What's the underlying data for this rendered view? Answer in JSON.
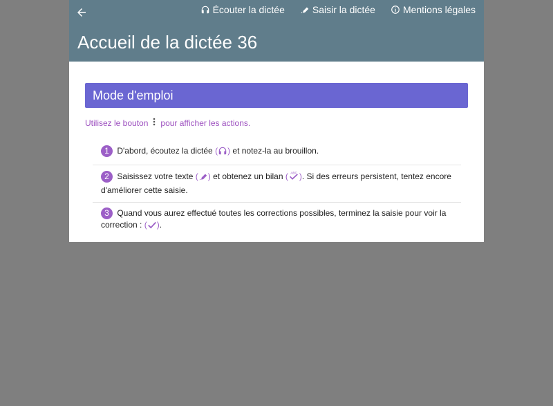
{
  "header": {
    "title": "Accueil de la dictée 36",
    "background": "#607d8b",
    "nav": [
      {
        "icon": "headphones-icon",
        "label": "Écouter la dictée"
      },
      {
        "icon": "pen-icon",
        "label": "Saisir la dictée"
      },
      {
        "icon": "info-icon",
        "label": "Mentions légales"
      }
    ]
  },
  "panel": {
    "title": "Mode d'emploi",
    "color": "#6a66d2"
  },
  "hint": {
    "before": "Utilisez le bouton",
    "icon": "more-vertical-icon",
    "after": "pour afficher les actions."
  },
  "steps": [
    {
      "number": "1",
      "text_a": "D'abord, écoutez la dictée",
      "icon": "headphones-icon",
      "text_b": "et notez-la au brouillon."
    },
    {
      "number": "2",
      "text_a": "Saisissez votre texte",
      "icon_a": "pen-icon",
      "text_b": "et obtenez un bilan",
      "icon_b": "spellcheck-icon",
      "text_c": ". Si des erreurs persistent, tentez encore d'améliorer cette saisie."
    },
    {
      "number": "3",
      "text_a": "Quand vous aurez effectué toutes les corrections possibles, terminez la saisie pour voir la correction :",
      "icon": "check-icon",
      "text_b": "."
    }
  ],
  "colors": {
    "accent": "#9c5fc7",
    "page_bg": "#7f7f7f"
  }
}
